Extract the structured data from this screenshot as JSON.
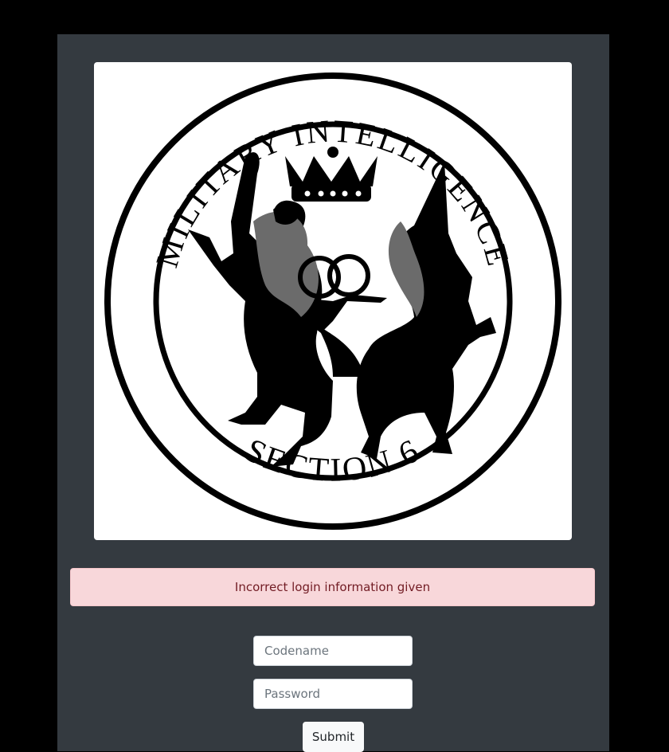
{
  "logo": {
    "top_text": "MILITARY INTELLIGENCE",
    "bottom_text": "SECTION 6"
  },
  "alert": {
    "message": "Incorrect login information given"
  },
  "form": {
    "codename_placeholder": "Codename",
    "password_placeholder": "Password",
    "submit_label": "Submit"
  },
  "colors": {
    "page_background": "#000000",
    "panel_background": "#343a40",
    "alert_background": "#f8d7da",
    "alert_text": "#721c24"
  }
}
